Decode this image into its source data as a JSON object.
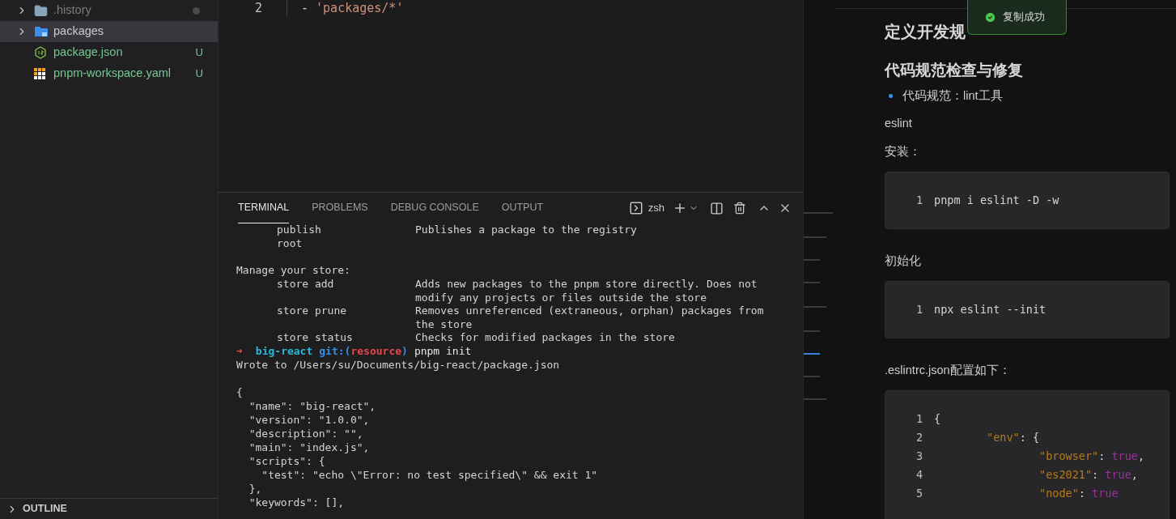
{
  "explorer": {
    "items": [
      {
        "name": ".history",
        "kind": "folder",
        "selected": false,
        "ignored": true
      },
      {
        "name": "packages",
        "kind": "package-folder",
        "selected": true,
        "ignored": false,
        "untracked": false
      },
      {
        "name": "package.json",
        "kind": "json-file",
        "selected": false,
        "ignored": false,
        "untracked": true,
        "badge": "U"
      },
      {
        "name": "pnpm-workspace.yaml",
        "kind": "yaml-file",
        "selected": false,
        "ignored": false,
        "untracked": true,
        "badge": "U"
      }
    ],
    "outline": {
      "label": "OUTLINE",
      "expanded": false
    }
  },
  "editor": {
    "lines": [
      {
        "number": "2",
        "tokens": [
          {
            "text": "- ",
            "kind": "plain"
          },
          {
            "text": "'packages/*'",
            "kind": "string"
          }
        ]
      }
    ]
  },
  "terminal": {
    "tabs": [
      {
        "label": "TERMINAL",
        "selected": true
      },
      {
        "label": "PROBLEMS",
        "selected": false
      },
      {
        "label": "DEBUG CONSOLE",
        "selected": false
      },
      {
        "label": "OUTPUT",
        "selected": false
      }
    ],
    "shell": "zsh",
    "lines": [
      {
        "kind": "help",
        "command": "publish",
        "description": "Publishes a package to the registry"
      },
      {
        "kind": "help",
        "command": "root"
      },
      {
        "kind": "blank"
      },
      {
        "kind": "text",
        "text": "Manage your store:"
      },
      {
        "kind": "help",
        "command": "store add",
        "description": "Adds new packages to the pnpm store directly. Does not modify any projects or files outside the store"
      },
      {
        "kind": "help",
        "command": "store prune",
        "description": "Removes unreferenced (extraneous, orphan) packages from the store"
      },
      {
        "kind": "help",
        "command": "store status",
        "description": "Checks for modified packages in the store"
      },
      {
        "kind": "prompt",
        "arrow": "➜",
        "dir": "big-react",
        "git": "git:(",
        "branch": "resource",
        "git_close": ")",
        "command": "pnpm init"
      },
      {
        "kind": "text",
        "text": "Wrote to /Users/su/Documents/big-react/package.json"
      },
      {
        "kind": "blank"
      },
      {
        "kind": "text",
        "text": "{"
      },
      {
        "kind": "text",
        "text": "  \"name\": \"big-react\","
      },
      {
        "kind": "text",
        "text": "  \"version\": \"1.0.0\","
      },
      {
        "kind": "text",
        "text": "  \"description\": \"\","
      },
      {
        "kind": "text",
        "text": "  \"main\": \"index.js\","
      },
      {
        "kind": "text",
        "text": "  \"scripts\": {"
      },
      {
        "kind": "text",
        "text": "    \"test\": \"echo \\\"Error: no test specified\\\" && exit 1\""
      },
      {
        "kind": "text",
        "text": "  },"
      },
      {
        "kind": "text",
        "text": "  \"keywords\": [],"
      }
    ]
  },
  "document": {
    "blocks": [
      {
        "kind": "heading1",
        "text": "定义开发规"
      },
      {
        "kind": "heading2",
        "text": "代码规范检查与修复"
      },
      {
        "kind": "bullet",
        "text": "代码规范：lint工具"
      },
      {
        "kind": "paragraph",
        "text": "eslint"
      },
      {
        "kind": "paragraph",
        "text": "安装："
      },
      {
        "kind": "code",
        "lines": [
          {
            "number": "1",
            "tokens": [
              {
                "text": "pnpm i eslint -D -w",
                "kind": "plain"
              }
            ]
          }
        ]
      },
      {
        "kind": "paragraph",
        "text": "初始化"
      },
      {
        "kind": "code",
        "lines": [
          {
            "number": "1",
            "tokens": [
              {
                "text": "npx eslint --init",
                "kind": "plain"
              }
            ]
          }
        ]
      },
      {
        "kind": "paragraph",
        "text": ".eslintrc.json配置如下："
      },
      {
        "kind": "code",
        "lines": [
          {
            "number": "1",
            "tokens": [
              {
                "text": "{",
                "kind": "punct"
              }
            ]
          },
          {
            "number": "2",
            "tokens": [
              {
                "text": "        \"env\"",
                "kind": "key"
              },
              {
                "text": ": {",
                "kind": "punct"
              }
            ]
          },
          {
            "number": "3",
            "tokens": [
              {
                "text": "                \"browser\"",
                "kind": "key"
              },
              {
                "text": ": ",
                "kind": "punct"
              },
              {
                "text": "true",
                "kind": "bool"
              },
              {
                "text": ",",
                "kind": "punct"
              }
            ]
          },
          {
            "number": "4",
            "tokens": [
              {
                "text": "                \"es2021\"",
                "kind": "key"
              },
              {
                "text": ": ",
                "kind": "punct"
              },
              {
                "text": "true",
                "kind": "bool"
              },
              {
                "text": ",",
                "kind": "punct"
              }
            ]
          },
          {
            "number": "5",
            "tokens": [
              {
                "text": "                \"node\"",
                "kind": "key"
              },
              {
                "text": ": ",
                "kind": "punct"
              },
              {
                "text": "true",
                "kind": "bool"
              }
            ]
          }
        ]
      }
    ]
  },
  "toast": {
    "message": "复制成功"
  }
}
